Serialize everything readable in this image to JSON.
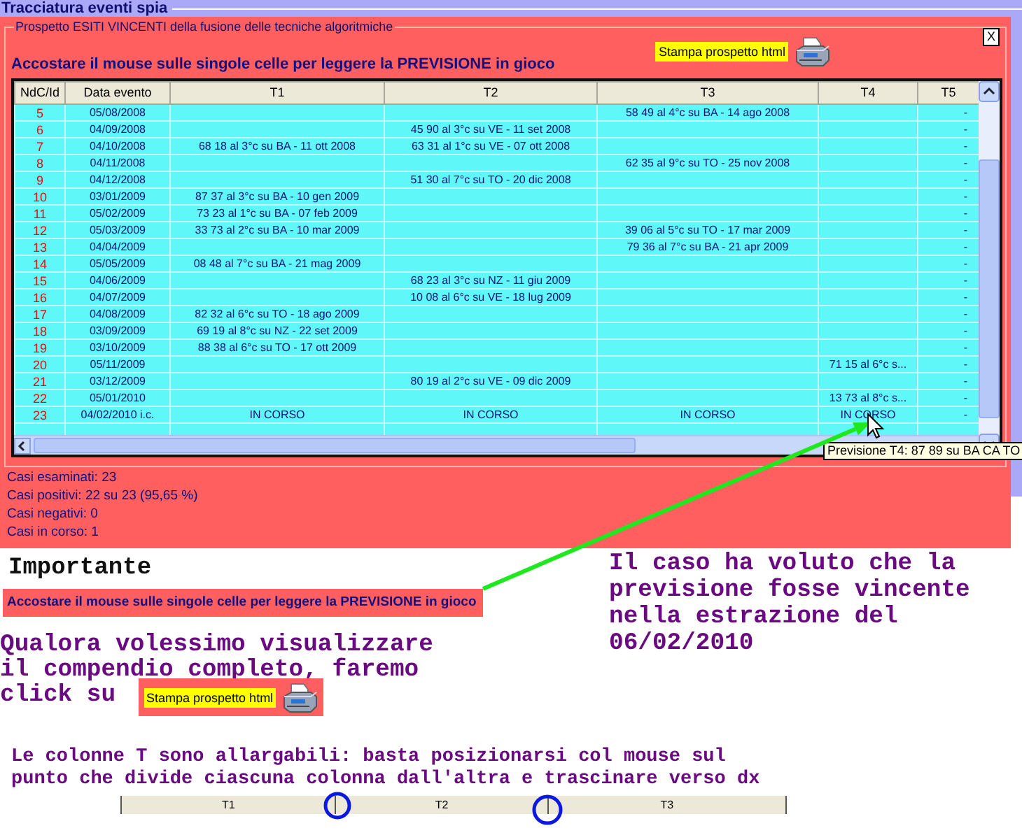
{
  "window": {
    "title": "Tracciatura eventi spia"
  },
  "panel": {
    "legend": "Prospetto ESITI VINCENTI della fusione delle tecniche algoritmiche",
    "heading": "Accostare il mouse sulle singole celle per leggere la PREVISIONE in gioco",
    "print_button": "Stampa prospetto html",
    "close_button": "X"
  },
  "table": {
    "columns": [
      "NdC/Id",
      "Data evento",
      "T1",
      "T2",
      "T3",
      "T4",
      "T5"
    ],
    "rows": [
      {
        "cells": [
          "5",
          "05/08/2008",
          null,
          null,
          "58 49 al 4°c su BA - 14 ago 2008",
          null,
          "-"
        ]
      },
      {
        "cells": [
          "6",
          "04/09/2008",
          null,
          "45 90 al 3°c su VE - 11 set 2008",
          null,
          null,
          "-"
        ]
      },
      {
        "cells": [
          "7",
          "04/10/2008",
          "68 18 al 3°c su BA - 11 ott 2008",
          "63 31 al 1°c su VE - 07 ott 2008",
          null,
          null,
          "-"
        ]
      },
      {
        "cells": [
          "8",
          "04/11/2008",
          null,
          null,
          "62 35 al 9°c su TO - 25 nov 2008",
          null,
          "-"
        ]
      },
      {
        "cells": [
          "9",
          "04/12/2008",
          null,
          "51 30 al 7°c su TO - 20 dic 2008",
          null,
          null,
          "-"
        ]
      },
      {
        "cells": [
          "10",
          "03/01/2009",
          "87 37 al 3°c su BA - 10 gen 2009",
          null,
          null,
          null,
          "-"
        ]
      },
      {
        "cells": [
          "11",
          "05/02/2009",
          "73 23 al 1°c su BA - 07 feb 2009",
          null,
          null,
          null,
          "-"
        ]
      },
      {
        "cells": [
          "12",
          "05/03/2009",
          "33 73 al 2°c su BA - 10 mar 2009",
          null,
          "39 06 al 5°c su TO - 17 mar 2009",
          null,
          "-"
        ]
      },
      {
        "cells": [
          "13",
          "04/04/2009",
          null,
          null,
          "79 36 al 7°c su BA - 21 apr 2009",
          null,
          "-"
        ]
      },
      {
        "cells": [
          "14",
          "05/05/2009",
          "08 48 al 7°c su BA - 21 mag 2009",
          null,
          null,
          null,
          "-"
        ]
      },
      {
        "cells": [
          "15",
          "04/06/2009",
          null,
          "68 23 al 3°c su NZ - 11 giu 2009",
          null,
          null,
          "-"
        ]
      },
      {
        "cells": [
          "16",
          "04/07/2009",
          null,
          "10 08 al 6°c su VE - 18 lug 2009",
          null,
          null,
          "-"
        ]
      },
      {
        "cells": [
          "17",
          "04/08/2009",
          "82 32 al 6°c su TO - 18 ago 2009",
          null,
          null,
          null,
          "-"
        ]
      },
      {
        "cells": [
          "18",
          "03/09/2009",
          "69 19 al 8°c su NZ - 22 set 2009",
          null,
          null,
          null,
          "-"
        ]
      },
      {
        "cells": [
          "19",
          "03/10/2009",
          "88 38 al 6°c su TO - 17 ott 2009",
          null,
          null,
          null,
          "-"
        ]
      },
      {
        "cells": [
          "20",
          "05/11/2009",
          null,
          null,
          null,
          "71 15 al 6°c s...",
          "-"
        ]
      },
      {
        "cells": [
          "21",
          "03/12/2009",
          null,
          "80 19 al 2°c su VE - 09 dic 2009",
          null,
          null,
          "-"
        ]
      },
      {
        "cells": [
          "22",
          "05/01/2010",
          null,
          null,
          null,
          "13 73 al 8°c s...",
          "-"
        ]
      },
      {
        "cells": [
          "23",
          "04/02/2010 i.c.",
          "IN CORSO",
          "IN CORSO",
          "IN CORSO",
          "IN CORSO",
          "-"
        ]
      }
    ]
  },
  "tooltip": "Previsione T4: 87 89 su BA CA TO",
  "summary": [
    "Casi esaminati: 23",
    "Casi positivi: 22 su 23 (95,65 %)",
    "Casi negativi: 0",
    "Casi in corso: 1"
  ],
  "notes": {
    "important_title": "Importante",
    "hint": "Accostare il mouse sulle singole celle per leggere la PREVISIONE in gioco",
    "left_lines": [
      "Qualora volessimo visualizzare",
      "il compendio completo, faremo",
      "click su"
    ],
    "print_button": "Stampa prospetto html",
    "right_lines": [
      "Il caso ha voluto che la",
      "previsione fosse vincente",
      "nella estrazione del",
      "06/02/2010"
    ],
    "bottom_lines": [
      "Le colonne T sono allargabili: basta posizionarsi col mouse sul",
      "punto che divide ciascuna colonna dall'altra e trascinare verso dx"
    ],
    "mini_columns": [
      "T1",
      "T2",
      "T3"
    ]
  }
}
